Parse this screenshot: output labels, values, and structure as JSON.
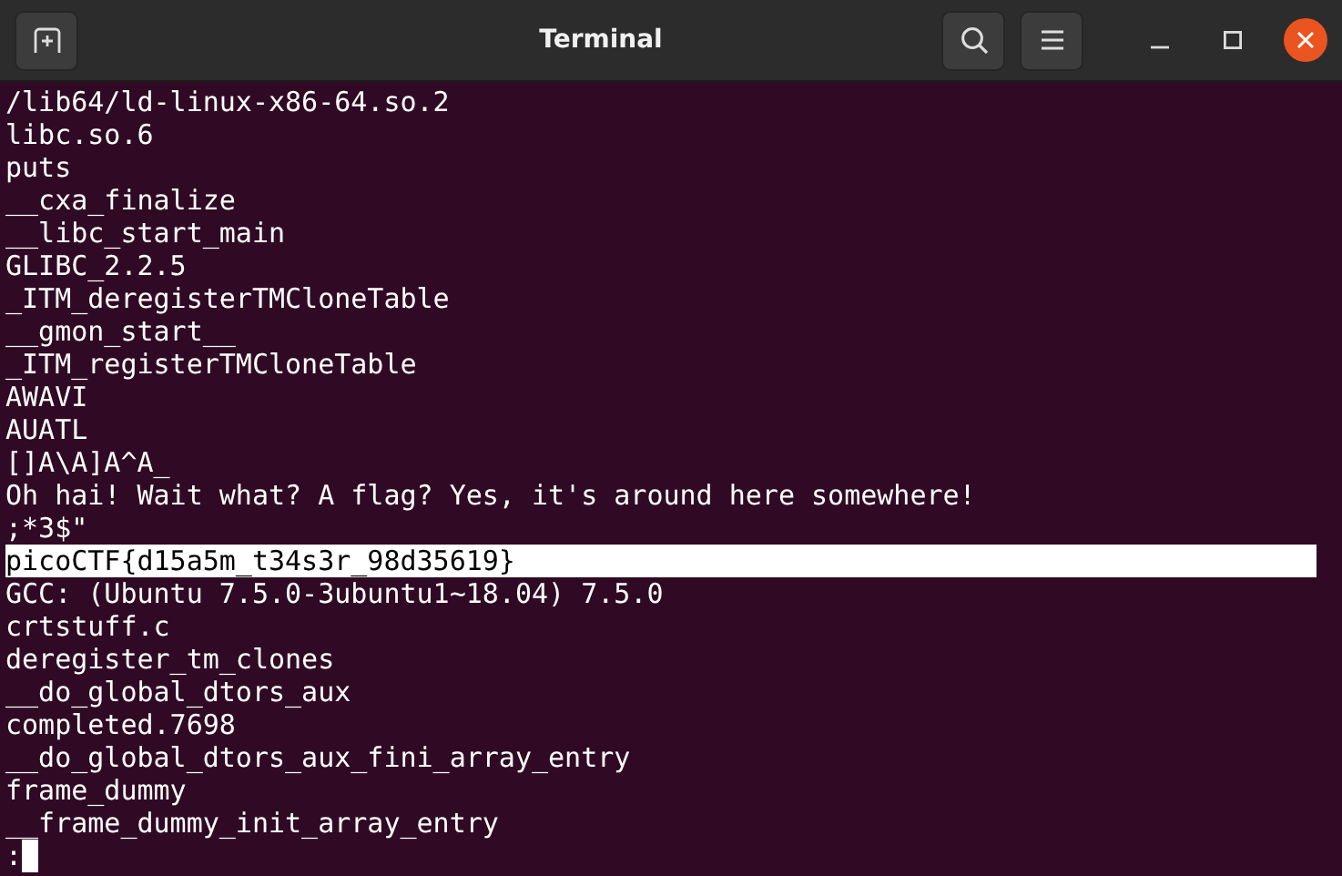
{
  "window": {
    "title": "Terminal"
  },
  "lines": [
    {
      "text": "/lib64/ld-linux-x86-64.so.2",
      "selected": false
    },
    {
      "text": "libc.so.6",
      "selected": false
    },
    {
      "text": "puts",
      "selected": false
    },
    {
      "text": "__cxa_finalize",
      "selected": false
    },
    {
      "text": "__libc_start_main",
      "selected": false
    },
    {
      "text": "GLIBC_2.2.5",
      "selected": false
    },
    {
      "text": "_ITM_deregisterTMCloneTable",
      "selected": false
    },
    {
      "text": "__gmon_start__",
      "selected": false
    },
    {
      "text": "_ITM_registerTMCloneTable",
      "selected": false
    },
    {
      "text": "AWAVI",
      "selected": false
    },
    {
      "text": "AUATL",
      "selected": false
    },
    {
      "text": "[]A\\A]A^A_",
      "selected": false
    },
    {
      "text": "Oh hai! Wait what? A flag? Yes, it's around here somewhere!",
      "selected": false
    },
    {
      "text": ";*3$\"",
      "selected": false
    },
    {
      "text": "picoCTF{d15a5m_t34s3r_98d35619}",
      "selected": true
    },
    {
      "text": "GCC: (Ubuntu 7.5.0-3ubuntu1~18.04) 7.5.0",
      "selected": false
    },
    {
      "text": "crtstuff.c",
      "selected": false
    },
    {
      "text": "deregister_tm_clones",
      "selected": false
    },
    {
      "text": "__do_global_dtors_aux",
      "selected": false
    },
    {
      "text": "completed.7698",
      "selected": false
    },
    {
      "text": "__do_global_dtors_aux_fini_array_entry",
      "selected": false
    },
    {
      "text": "frame_dummy",
      "selected": false
    },
    {
      "text": "__frame_dummy_init_array_entry",
      "selected": false
    }
  ],
  "prompt": {
    "text": ":"
  }
}
